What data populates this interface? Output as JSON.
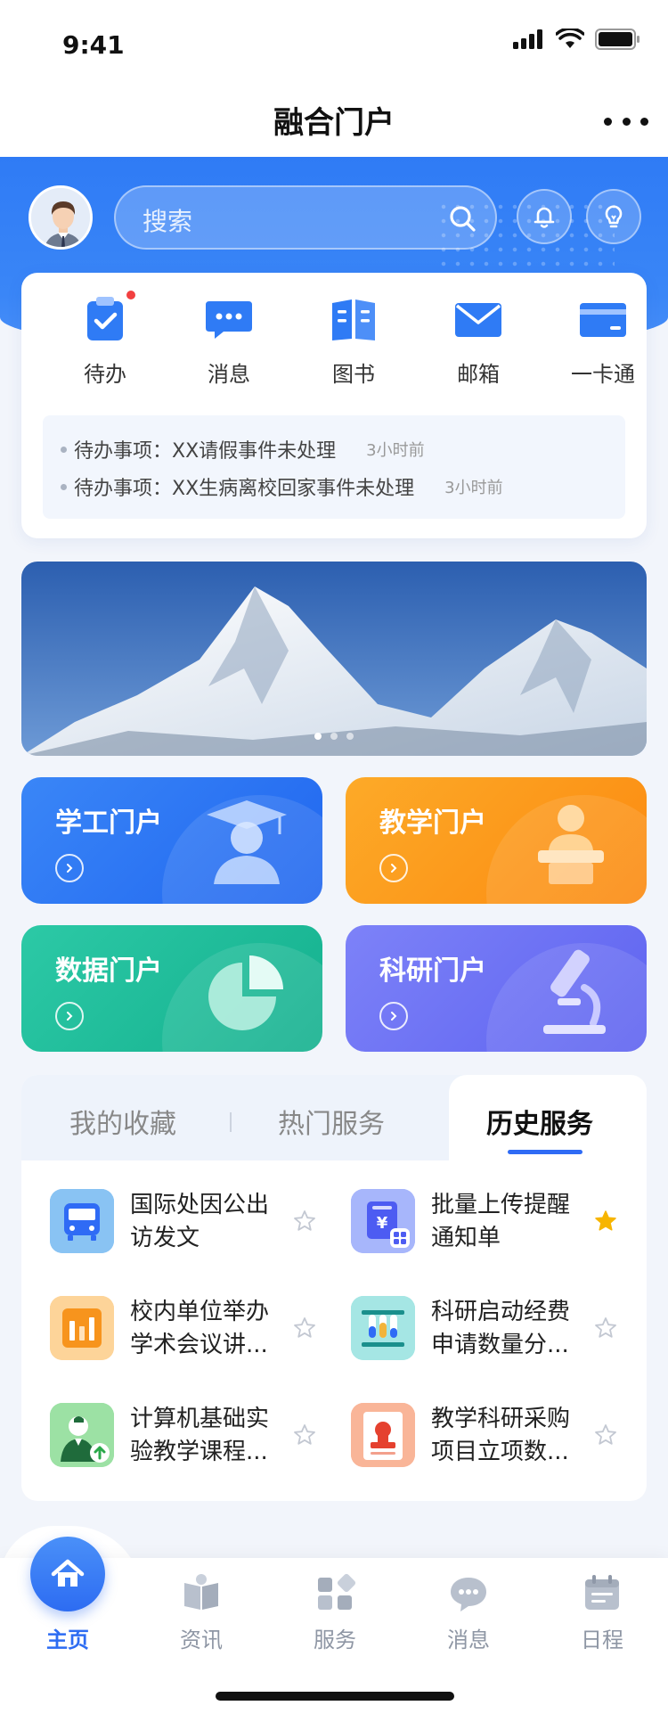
{
  "status_bar": {
    "time": "9:41"
  },
  "nav": {
    "title": "融合门户"
  },
  "search": {
    "placeholder": "搜索"
  },
  "quick_actions": [
    {
      "label": "待办",
      "icon": "todo-clipboard-icon",
      "badge": true
    },
    {
      "label": "消息",
      "icon": "message-bubble-icon"
    },
    {
      "label": "图书",
      "icon": "book-icon"
    },
    {
      "label": "邮箱",
      "icon": "mail-icon"
    },
    {
      "label": "一卡通",
      "icon": "card-icon"
    }
  ],
  "todos": [
    {
      "text": "待办事项：XX请假事件未处理",
      "time": "3小时前"
    },
    {
      "text": "待办事项：XX生病离校回家事件未处理",
      "time": "3小时前"
    }
  ],
  "banner": {
    "slides": 3,
    "active": 0
  },
  "portals": [
    {
      "title": "学工门户",
      "color": "#2f7bf5",
      "icon": "graduate-icon"
    },
    {
      "title": "教学门户",
      "color": "#fb9a17",
      "icon": "lecture-podium-icon"
    },
    {
      "title": "数据门户",
      "color": "#1fbf9c",
      "icon": "pie-chart-icon"
    },
    {
      "title": "科研门户",
      "color": "#6b70f5",
      "icon": "microscope-icon"
    }
  ],
  "tabs": [
    {
      "label": "我的收藏"
    },
    {
      "label": "热门服务"
    },
    {
      "label": "历史服务",
      "active": true
    }
  ],
  "services": [
    {
      "line1": "国际处因公出",
      "line2": "访发文",
      "starred": false,
      "icon": "bus-icon"
    },
    {
      "line1": "批量上传提醒",
      "line2": "通知单",
      "starred": true,
      "icon": "yuan-notice-icon"
    },
    {
      "line1": "校内单位举办",
      "line2": "学术会议讲...",
      "starred": false,
      "icon": "bar-chart-icon"
    },
    {
      "line1": "科研启动经费",
      "line2": "申请数量分...",
      "starred": false,
      "icon": "test-tubes-icon"
    },
    {
      "line1": "计算机基础实",
      "line2": "验教学课程...",
      "starred": false,
      "icon": "teacher-upload-icon"
    },
    {
      "line1": "教学科研采购",
      "line2": "项目立项数...",
      "starred": false,
      "icon": "certificate-stamp-icon"
    }
  ],
  "bottom_tabs": [
    {
      "label": "主页",
      "active": true,
      "icon": "home-icon"
    },
    {
      "label": "资讯",
      "icon": "news-icon"
    },
    {
      "label": "服务",
      "icon": "grid-services-icon"
    },
    {
      "label": "消息",
      "icon": "chat-icon"
    },
    {
      "label": "日程",
      "icon": "calendar-icon"
    }
  ],
  "colors": {
    "primary": "#2f6bf5",
    "star": "#f7b500"
  }
}
